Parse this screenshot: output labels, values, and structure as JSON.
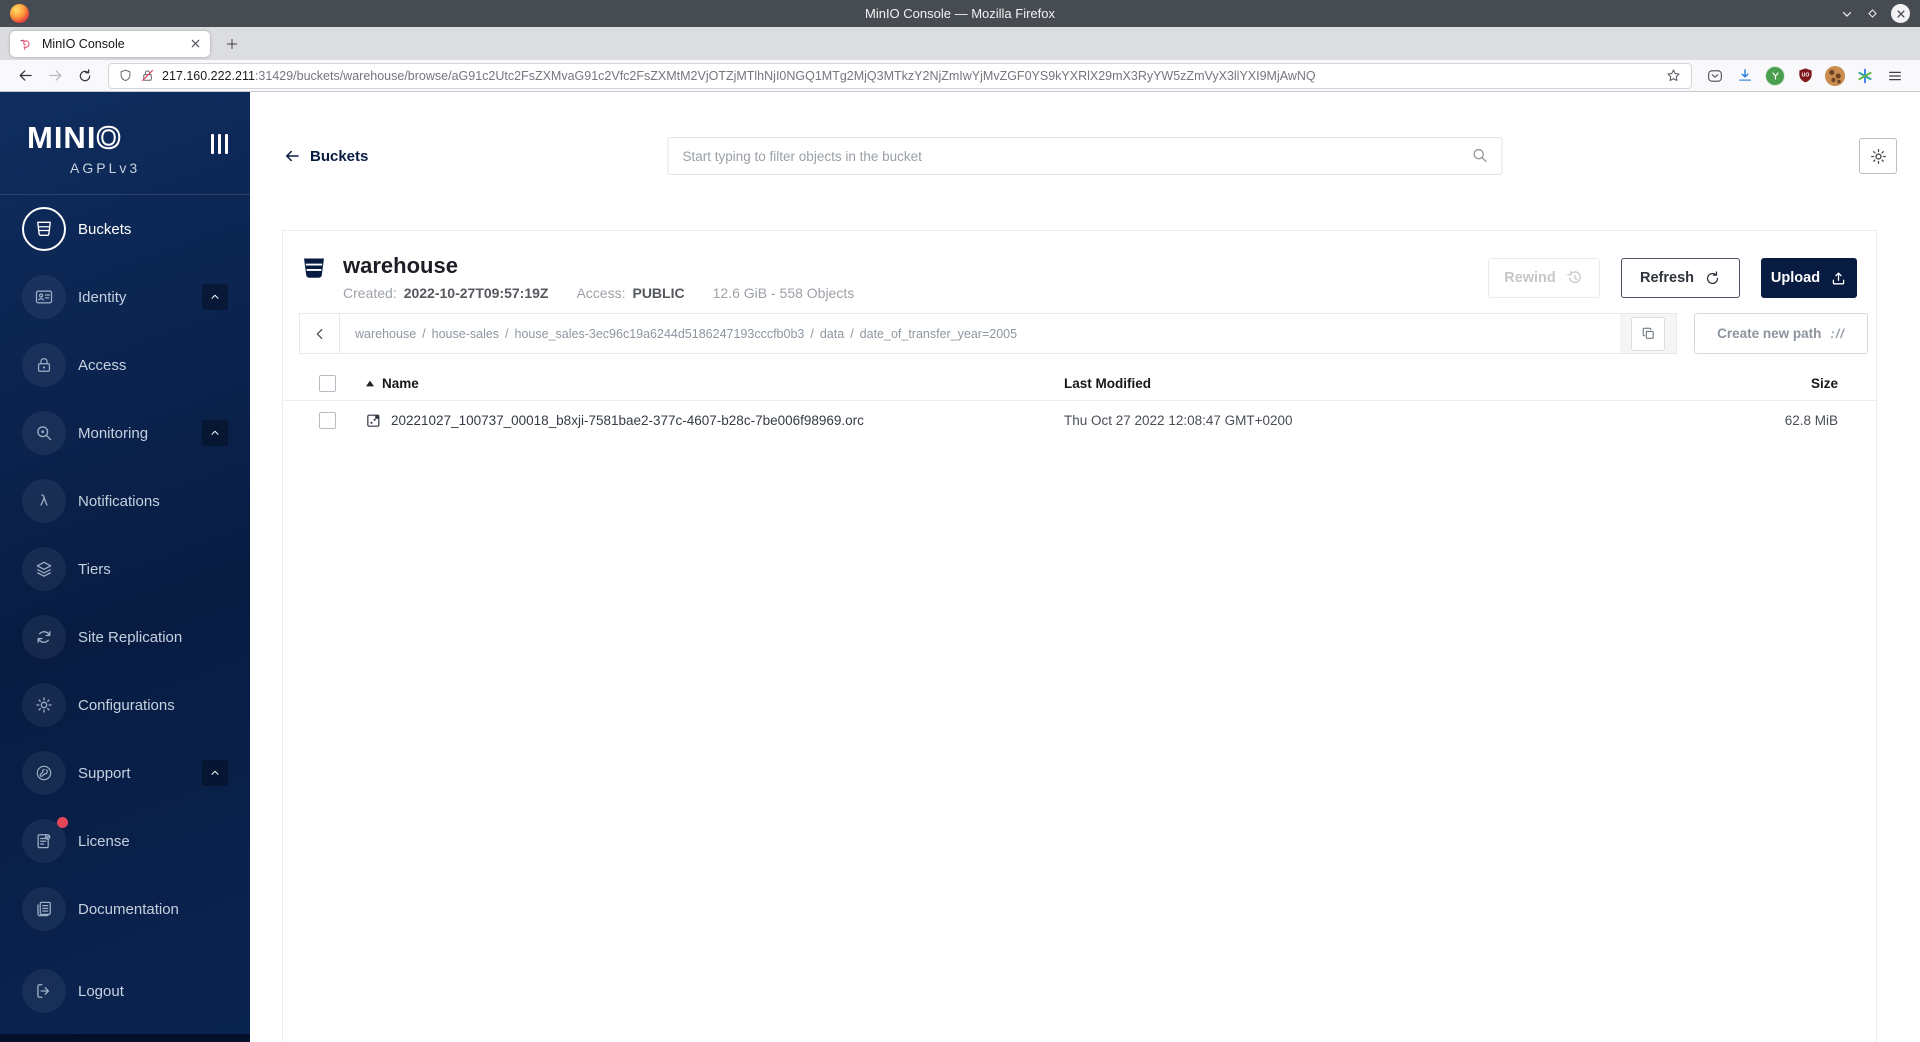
{
  "colors": {
    "accent_navy": "#081c42",
    "badge_red": "#e54558",
    "download_blue": "#2b7de0"
  },
  "window": {
    "title": "MinIO Console — Mozilla Firefox"
  },
  "browser": {
    "tab_title": "MinIO Console",
    "url_host": "217.160.222.211",
    "url_rest": ":31429/buckets/warehouse/browse/aG91c2Utc2FsZXMvaG91c2Vfc2FsZXMtM2VjOTZjMTlhNjI0NGQ1MTg2MjQ3MTkzY2NjZmIwYjMvZGF0YS9kYXRlX29mX3RyYW5zZmVyX3llYXI9MjAwNQ"
  },
  "sidebar": {
    "wordmark_solid": "MINI",
    "wordmark_outline": "O",
    "license_tag": "AGPLv3",
    "items": [
      {
        "label": "Buckets"
      },
      {
        "label": "Identity"
      },
      {
        "label": "Access"
      },
      {
        "label": "Monitoring"
      },
      {
        "label": "Notifications"
      },
      {
        "label": "Tiers"
      },
      {
        "label": "Site Replication"
      },
      {
        "label": "Configurations"
      },
      {
        "label": "Support"
      },
      {
        "label": "License"
      },
      {
        "label": "Documentation"
      },
      {
        "label": "Logout"
      }
    ]
  },
  "header": {
    "back_label": "Buckets",
    "search_placeholder": "Start typing to filter objects in the bucket"
  },
  "bucket": {
    "name": "warehouse",
    "created_label": "Created:",
    "created_value": "2022-10-27T09:57:19Z",
    "access_label": "Access:",
    "access_value": "PUBLIC",
    "summary": "12.6 GiB - 558 Objects",
    "rewind_label": "Rewind",
    "refresh_label": "Refresh",
    "upload_label": "Upload"
  },
  "browse": {
    "separator": "/",
    "path_segments": [
      "warehouse",
      "house-sales",
      "house_sales-3ec96c19a6244d5186247193cccfb0b3",
      "data",
      "date_of_transfer_year=2005"
    ],
    "create_path_label": "Create new path",
    "create_path_glyph": "://"
  },
  "table": {
    "col_name": "Name",
    "col_modified": "Last Modified",
    "col_size": "Size",
    "rows": [
      {
        "name": "20221027_100737_00018_b8xji-7581bae2-377c-4607-b28c-7be006f98969.orc",
        "modified": "Thu Oct 27 2022 12:08:47 GMT+0200",
        "size": "62.8 MiB"
      }
    ]
  }
}
